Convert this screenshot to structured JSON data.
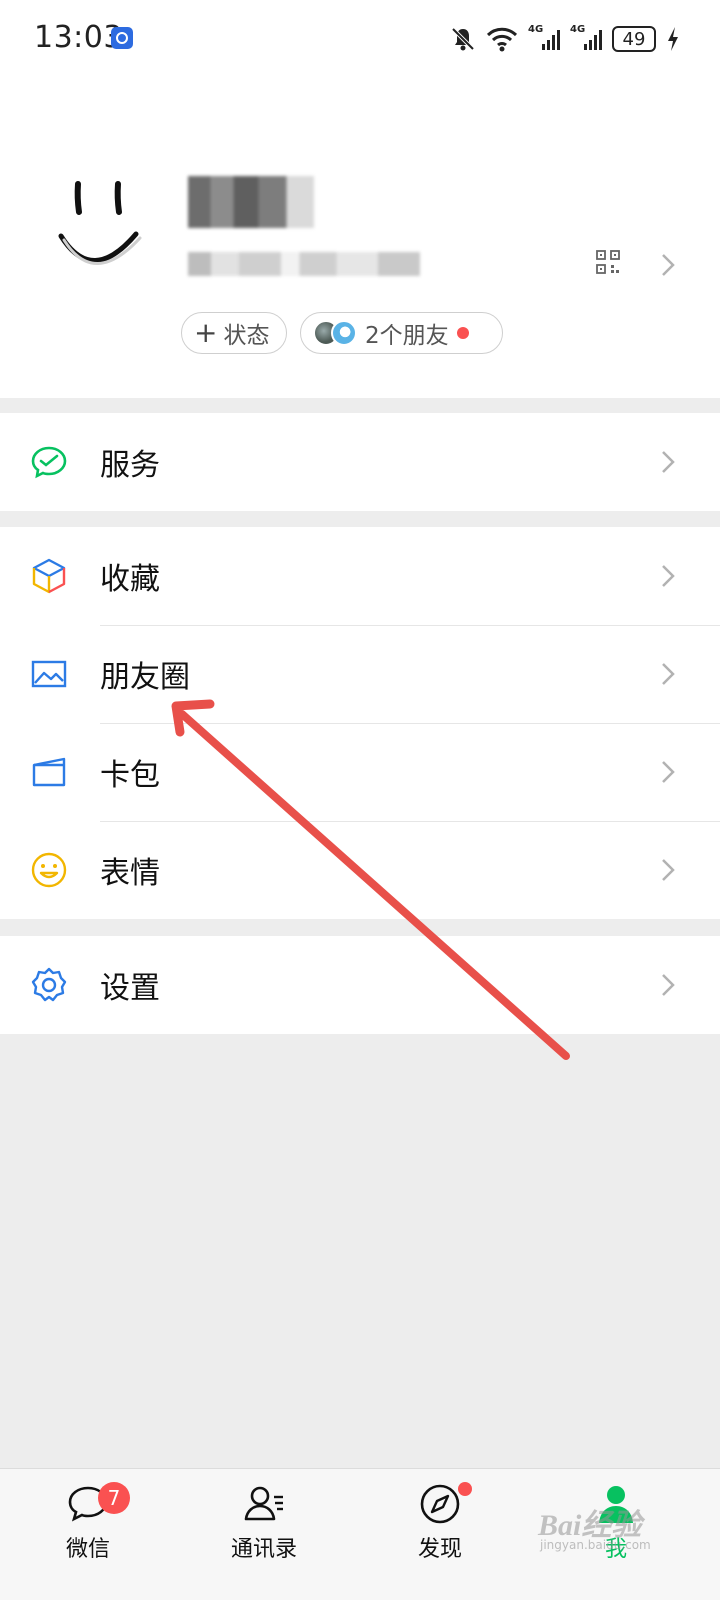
{
  "status_bar": {
    "time": "13:03",
    "network_tag_1": "4G",
    "network_tag_2": "4G",
    "battery": "49"
  },
  "profile": {
    "status_pill_label": "状态",
    "friends_pill_label": "2个朋友"
  },
  "menu": {
    "group1": [
      {
        "label": "服务",
        "icon": "wechat-pay-icon",
        "color": "#07c160"
      }
    ],
    "group2": [
      {
        "label": "收藏",
        "icon": "favorites-cube-icon",
        "color": "#f2b600"
      },
      {
        "label": "朋友圈",
        "icon": "moments-image-icon",
        "color": "#2c7be5"
      },
      {
        "label": "卡包",
        "icon": "card-wallet-icon",
        "color": "#2c7be5"
      },
      {
        "label": "表情",
        "icon": "sticker-smile-icon",
        "color": "#f2b600"
      }
    ],
    "group3": [
      {
        "label": "设置",
        "icon": "settings-gear-icon",
        "color": "#2c7be5"
      }
    ]
  },
  "tabbar": {
    "tabs": [
      {
        "label": "微信",
        "icon": "chat-bubble-icon"
      },
      {
        "label": "通讯录",
        "icon": "contacts-icon"
      },
      {
        "label": "发现",
        "icon": "compass-icon"
      },
      {
        "label": "我",
        "icon": "me-person-icon"
      }
    ],
    "chats_badge": "7",
    "active_color": "#07c160",
    "badge_color": "#fa5151"
  },
  "watermark": {
    "text": "Bai经验",
    "sub": "jingyan.baidu.com"
  }
}
